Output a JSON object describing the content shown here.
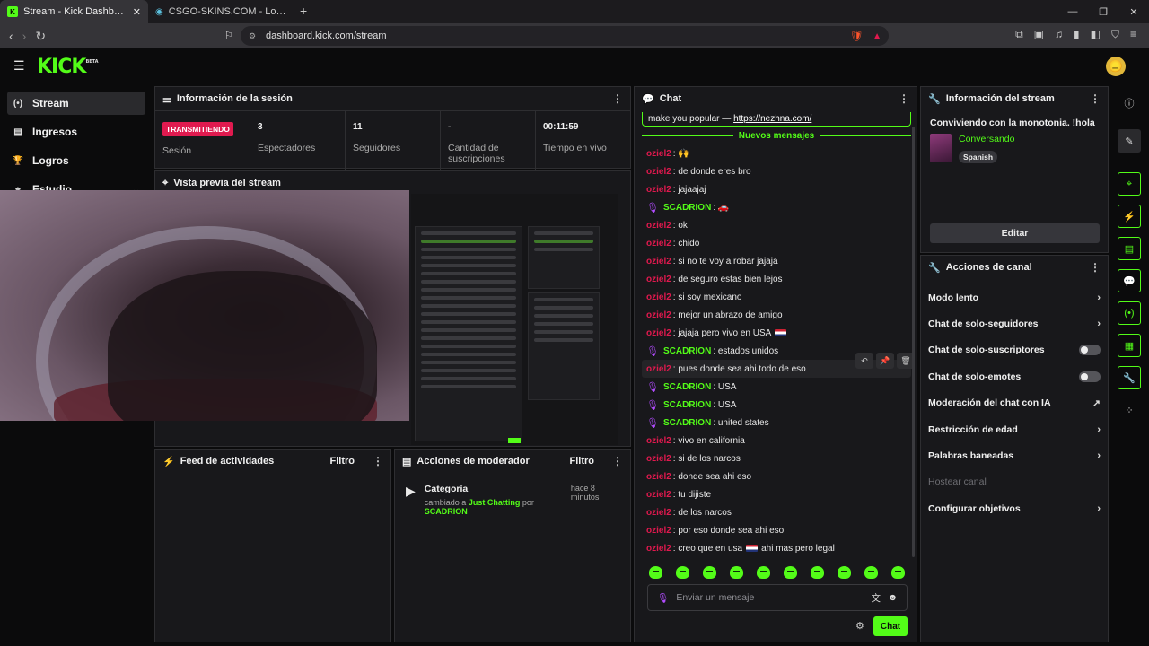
{
  "browser": {
    "tabs": [
      {
        "title": "Stream - Kick Dashboard",
        "active": true
      },
      {
        "title": "CSGO-SKINS.COM - Los mejores cas",
        "active": false
      }
    ],
    "url": "dashboard.kick.com/stream"
  },
  "app": {
    "logo": "KICK",
    "logo_beta": "BETA",
    "avatar_icon": "avatar-emoji"
  },
  "sidebar": {
    "items": [
      {
        "label": "Stream",
        "icon": "stream-icon",
        "active": true
      },
      {
        "label": "Ingresos",
        "icon": "income-icon"
      },
      {
        "label": "Logros",
        "icon": "trophy-icon"
      },
      {
        "label": "Estudio",
        "icon": "studio-icon"
      }
    ]
  },
  "session": {
    "title": "Información de la sesión",
    "status_badge": "TRANSMITIENDO",
    "status_label": "Sesión",
    "stats": [
      {
        "value": "3",
        "label": "Espectadores"
      },
      {
        "value": "11",
        "label": "Seguidores"
      },
      {
        "value": "-",
        "label": "Cantidad de suscripciones"
      },
      {
        "value": "00:11:59",
        "label": "Tiempo en vivo"
      }
    ]
  },
  "preview": {
    "title": "Vista previa del stream"
  },
  "activity": {
    "title": "Feed de actividades",
    "filter": "Filtro"
  },
  "mod_actions": {
    "title": "Acciones de moderador",
    "filter": "Filtro",
    "entries": [
      {
        "title": "Categoría",
        "time": "hace 8 minutos",
        "desc_prefix": "cambiado a",
        "category": "Just Chatting",
        "by": "por",
        "user": "SCADRION"
      }
    ]
  },
  "chat": {
    "title": "Chat",
    "pinned": "make you popular — ",
    "pinned_link": "https://nezhna.com/",
    "new_messages": "Nuevos mensajes",
    "messages": [
      {
        "user": "oziel2",
        "text": ": 🙌",
        "type": "u1"
      },
      {
        "user": "oziel2",
        "text": ": de donde eres bro",
        "type": "u1"
      },
      {
        "user": "oziel2",
        "text": ": jajaajaj",
        "type": "u1"
      },
      {
        "user": "SCADRION",
        "text": ": 🚗",
        "type": "u2"
      },
      {
        "user": "oziel2",
        "text": ": ok",
        "type": "u1"
      },
      {
        "user": "oziel2",
        "text": ": chido",
        "type": "u1"
      },
      {
        "user": "oziel2",
        "text": ": si no te voy a robar jajaja",
        "type": "u1"
      },
      {
        "user": "oziel2",
        "text": ": de seguro estas bien lejos",
        "type": "u1"
      },
      {
        "user": "oziel2",
        "text": ": si soy mexicano",
        "type": "u1"
      },
      {
        "user": "oziel2",
        "text": ": mejor un abrazo de amigo",
        "type": "u1"
      },
      {
        "user": "oziel2",
        "text": ": jajaja pero vivo en USA",
        "type": "u1",
        "flag": true
      },
      {
        "user": "SCADRION",
        "text": ": estados unidos",
        "type": "u2"
      },
      {
        "user": "oziel2",
        "text": ": pues donde sea ahi todo de eso",
        "type": "u1",
        "hl": true
      },
      {
        "user": "SCADRION",
        "text": ": USA",
        "type": "u2"
      },
      {
        "user": "SCADRION",
        "text": ": USA",
        "type": "u2"
      },
      {
        "user": "SCADRION",
        "text": ": united states",
        "type": "u2"
      },
      {
        "user": "oziel2",
        "text": ": vivo en california",
        "type": "u1"
      },
      {
        "user": "oziel2",
        "text": ": si de los narcos",
        "type": "u1"
      },
      {
        "user": "oziel2",
        "text": ": donde sea ahi eso",
        "type": "u1"
      },
      {
        "user": "oziel2",
        "text": ": tu dijiste",
        "type": "u1"
      },
      {
        "user": "oziel2",
        "text": ": de los narcos",
        "type": "u1"
      },
      {
        "user": "oziel2",
        "text": ": por eso donde sea ahi eso",
        "type": "u1"
      },
      {
        "user": "oziel2",
        "text": ": creo que en usa",
        "type": "u1",
        "flag": true,
        "after": " ahi mas pero legal"
      }
    ],
    "input_placeholder": "Enviar un mensaje",
    "send_label": "Chat"
  },
  "stream_info": {
    "title": "Información del stream",
    "stream_title": "Conviviendo con la monotonia. !hola",
    "category": "Conversando",
    "tag": "Spanish",
    "edit_label": "Editar"
  },
  "channel_actions": {
    "title": "Acciones de canal",
    "items": [
      {
        "label": "Modo lento",
        "control": "chevron"
      },
      {
        "label": "Chat de solo-seguidores",
        "control": "chevron"
      },
      {
        "label": "Chat de solo-suscriptores",
        "control": "toggle",
        "on": false
      },
      {
        "label": "Chat de solo-emotes",
        "control": "toggle",
        "on": false
      },
      {
        "label": "Moderación del chat con IA",
        "control": "external"
      },
      {
        "label": "Restricción de edad",
        "control": "chevron"
      },
      {
        "label": "Palabras baneadas",
        "control": "chevron"
      },
      {
        "label": "Hostear canal",
        "control": "none",
        "disabled": true
      },
      {
        "label": "Configurar objetivos",
        "control": "chevron"
      }
    ]
  },
  "accent_color": "#53fc18",
  "live_color": "#e01a4f"
}
